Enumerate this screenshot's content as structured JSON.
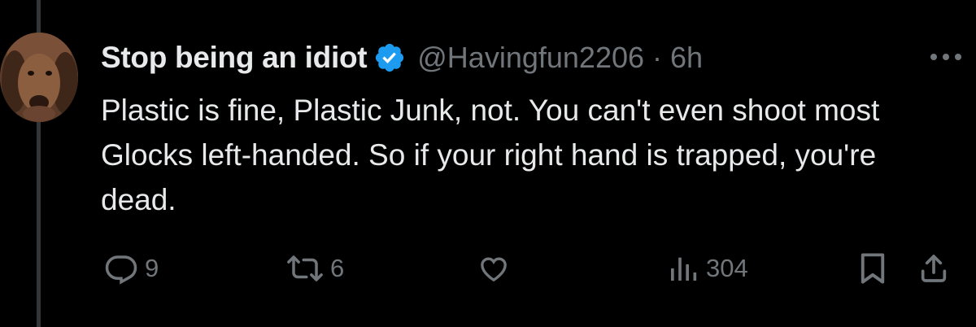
{
  "tweet": {
    "display_name": "Stop being an idiot",
    "handle": "@Havingfun2206",
    "separator": "·",
    "time": "6h",
    "text": "Plastic is fine, Plastic Junk, not. You can't even shoot most Glocks left-handed. So if your right hand is trapped, you're dead.",
    "verified": true,
    "avatar_icon": "bloodhound-dog-photo"
  },
  "actions": {
    "reply_count": "9",
    "retweet_count": "6",
    "like_count": "",
    "views_count": "304",
    "icons": [
      "reply-icon",
      "retweet-icon",
      "like-icon",
      "views-icon",
      "bookmark-icon",
      "share-icon"
    ]
  },
  "colors": {
    "background": "#000000",
    "text_primary": "#e7e9ea",
    "text_secondary": "#71767b",
    "verified_blue": "#1d9bf0",
    "thread_line": "#333639"
  }
}
